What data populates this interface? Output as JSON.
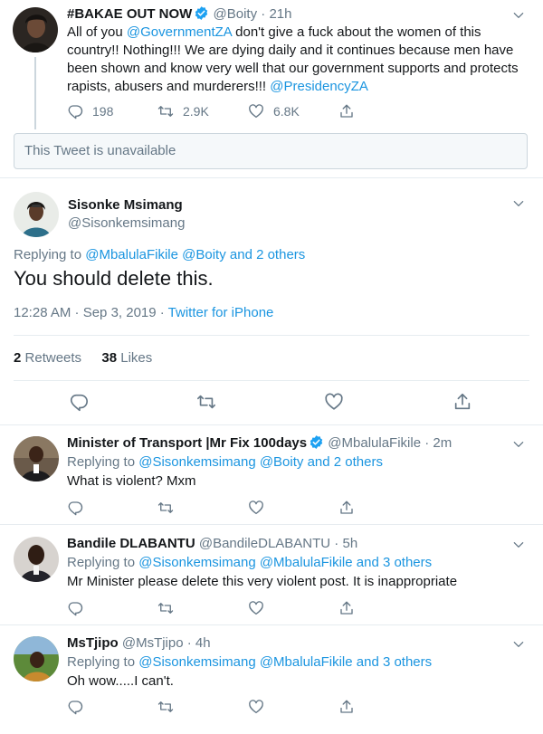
{
  "tweet1": {
    "name": "#BAKAE OUT NOW",
    "handle": "@Boity",
    "time": "21h",
    "text_pre": "All of you ",
    "mention1": "@GovernmentZA",
    "text_mid": " don't give a fuck about the women of this country!! Nothing!!! We are dying daily and it continues because men have been shown and know very well that our government supports and protects rapists, abusers and murderers!!! ",
    "mention2": "@PresidencyZA",
    "replies": "198",
    "retweets": "2.9K",
    "likes": "6.8K"
  },
  "unavailable": "This Tweet is unavailable",
  "main": {
    "name": "Sisonke Msimang",
    "handle": "@Sisonkemsimang",
    "replying_label": "Replying to ",
    "replying_to": "@MbalulaFikile @Boity and 2 others",
    "text": "You should delete this.",
    "timestamp": "12:28 AM · Sep 3, 2019 · ",
    "source": "Twitter for iPhone",
    "retweets_count": "2",
    "retweets_label": "Retweets",
    "likes_count": "38",
    "likes_label": "Likes"
  },
  "replies": [
    {
      "name": "Minister of Transport |Mr Fix 100days",
      "handle": "@MbalulaFikile",
      "time": "2m",
      "verified": true,
      "replying_label": "Replying to ",
      "replying_to": "@Sisonkemsimang @Boity and 2 others",
      "text": "What is violent? Mxm"
    },
    {
      "name": "Bandile DLABANTU",
      "handle": "@BandileDLABANTU",
      "time": "5h",
      "verified": false,
      "replying_label": "Replying to ",
      "replying_to": "@Sisonkemsimang @MbalulaFikile and 3 others",
      "text": "Mr Minister please delete this very violent post. It is inappropriate"
    },
    {
      "name": "MsTjipo",
      "handle": "@MsTjipo",
      "time": "4h",
      "verified": false,
      "replying_label": "Replying to ",
      "replying_to": "@Sisonkemsimang @MbalulaFikile and 3 others",
      "text": "Oh wow.....I can't."
    }
  ],
  "colors": {
    "link": "#1b95e0",
    "muted": "#657786",
    "verified": "#1da1f2",
    "border": "#e6ecf0"
  },
  "icons": [
    "chevron-down-icon",
    "reply-icon",
    "retweet-icon",
    "like-icon",
    "share-icon",
    "verified-icon"
  ]
}
